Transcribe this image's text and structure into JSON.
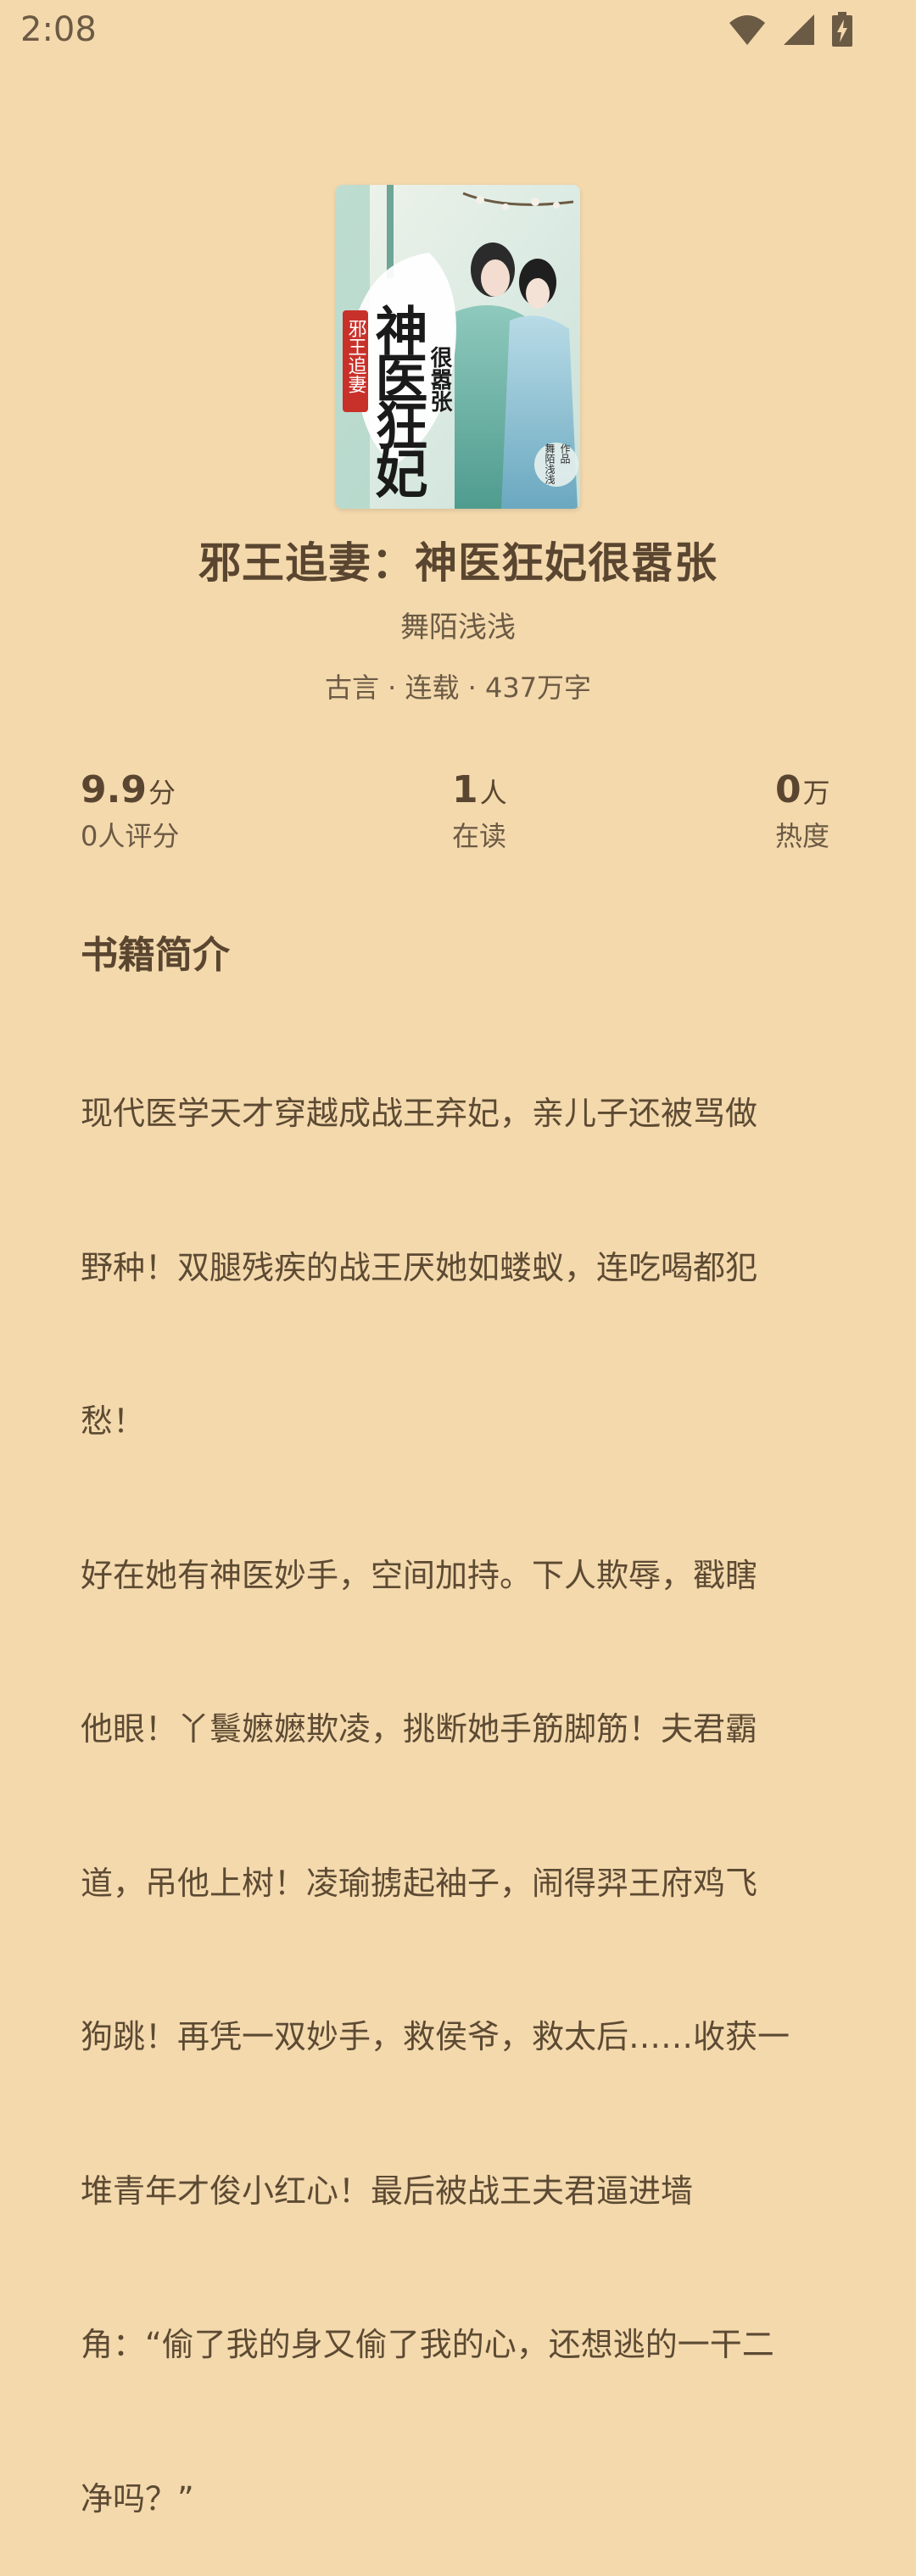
{
  "status_bar": {
    "time": "2:08",
    "icons": [
      "wifi-icon",
      "signal-icon",
      "battery-charging-icon"
    ]
  },
  "book": {
    "cover_icon": "book-cover-illustration",
    "cover_text": {
      "main": "神医狂妃",
      "side": "很嚣张",
      "seal": "邪王追妻",
      "badge_top": "作品",
      "badge_author": "舞陌浅浅"
    },
    "title": "邪王追妻：神医狂妃很嚣张",
    "author": "舞陌浅浅",
    "meta": "古言 · 连载 · 437万字"
  },
  "stats": {
    "rating": {
      "value": "9.9",
      "unit": "分",
      "label": "0人评分"
    },
    "readers": {
      "value": "1",
      "unit": "人",
      "label": "在读"
    },
    "heat": {
      "value": "0",
      "unit": "万",
      "label": "热度"
    }
  },
  "intro": {
    "heading": "书籍简介",
    "lines": [
      "现代医学天才穿越成战王弃妃，亲儿子还被骂做",
      "野种！双腿残疾的战王厌她如蝼蚁，连吃喝都犯",
      "愁！",
      "好在她有神医妙手，空间加持。下人欺辱，戳瞎",
      "他眼！丫鬟嬷嬷欺凌，挑断她手筋脚筋！夫君霸",
      "道，吊他上树！凌瑜掳起袖子，闹得羿王府鸡飞",
      "狗跳！再凭一双妙手，救侯爷，救太后……收获一",
      "堆青年才俊小红心！最后被战王夫君逼进墙",
      "角：“偷了我的身又偷了我的心，还想逃的一干二",
      "净吗？”"
    ]
  },
  "colors": {
    "background": "#f4d9ad",
    "text_dark": "#5a4630",
    "text_mid": "#6b5a44"
  }
}
